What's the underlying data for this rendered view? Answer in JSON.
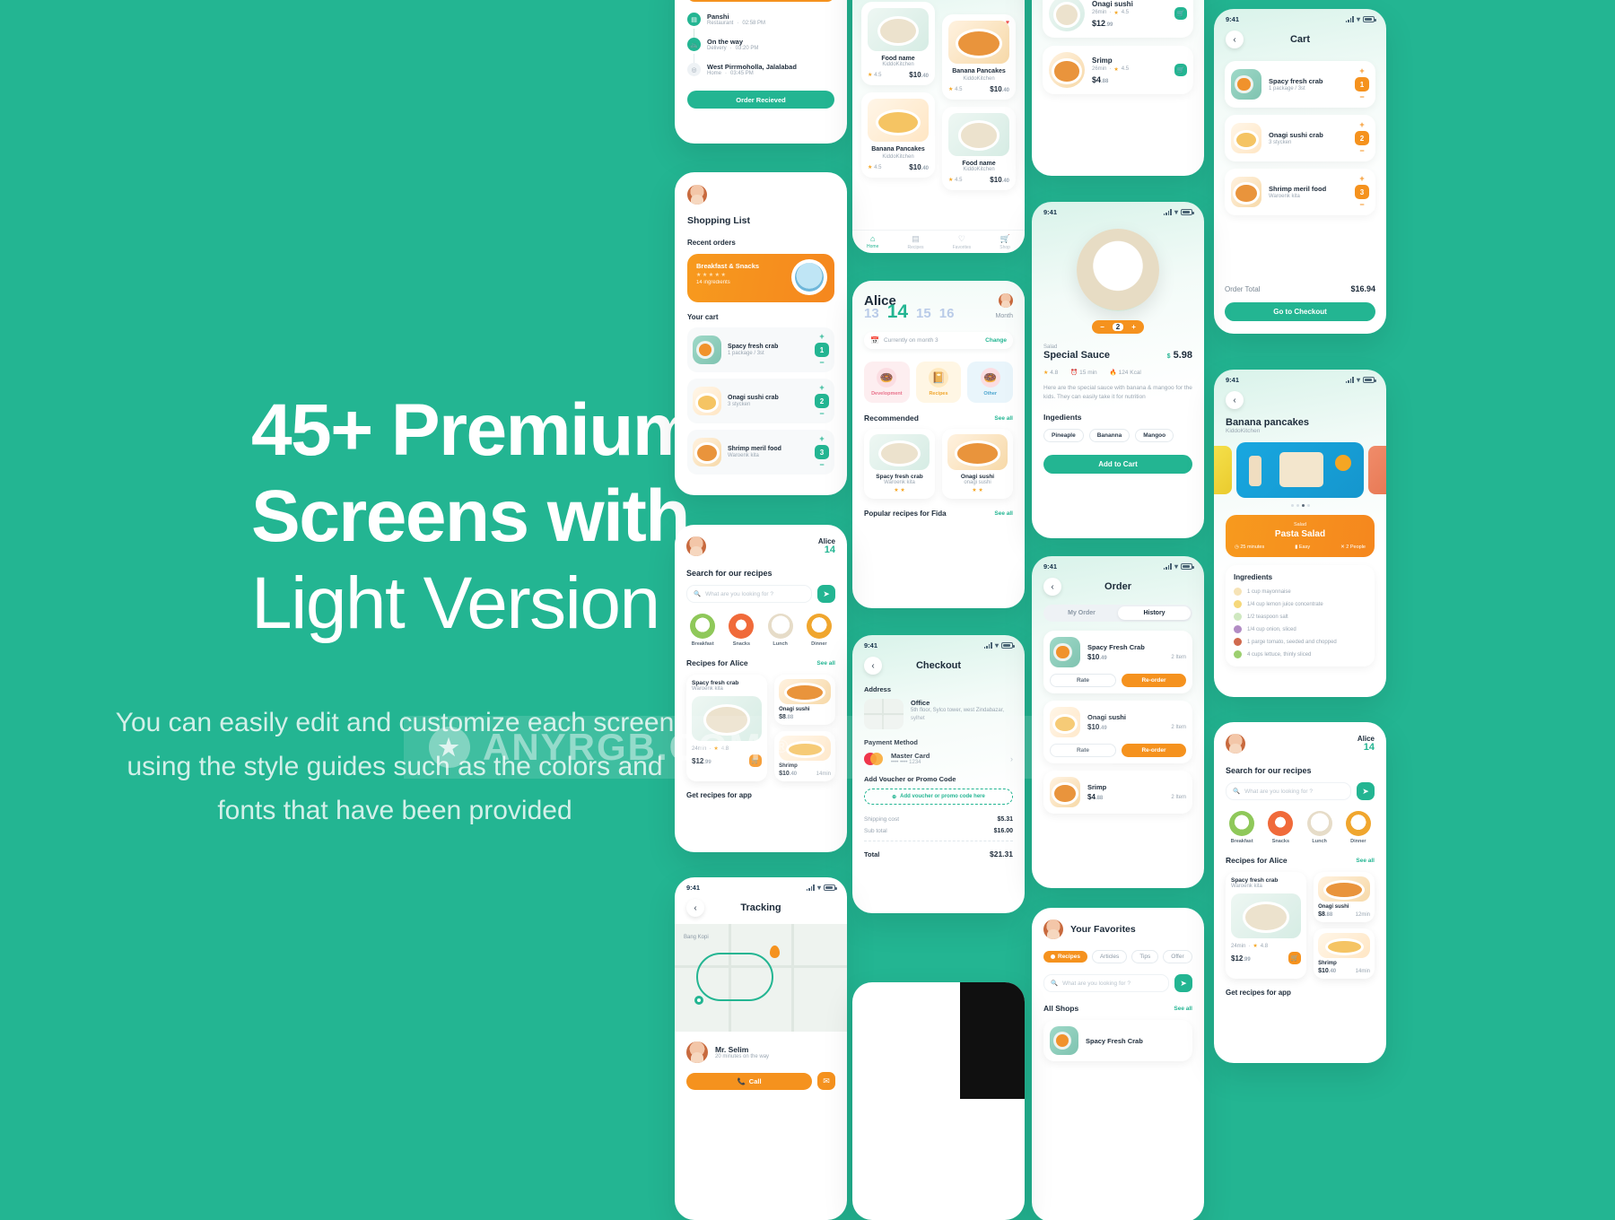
{
  "hero": {
    "title_line1": "45+ Premium",
    "title_line2": "Screens with",
    "title_line3": "Light Version",
    "subtitle": "You can easily edit and customize each screen using the style guides such as the colors and fonts that have been provided"
  },
  "watermark": {
    "text": "ANYRGB.COM",
    "reg": "®",
    "star": "★"
  },
  "colors": {
    "brand_green": "#23B592",
    "accent_orange": "#F5921E",
    "dark": "#1d2b3a",
    "muted": "#9aa6b2"
  },
  "status_bar": {
    "time": "9:41"
  },
  "screens": {
    "tracking_status": {
      "steps": [
        {
          "title": "Panshi",
          "sub": "Restaurant",
          "time": "02:58 PM",
          "icon": "store-icon"
        },
        {
          "title": "On the way",
          "sub": "Delivery",
          "time": "03:20 PM",
          "icon": "bike-icon"
        },
        {
          "title": "West Pirrmoholla, Jalalabad",
          "sub": "Home",
          "time": "03:45 PM",
          "icon": "pin-icon"
        }
      ],
      "button": "Order Recieved"
    },
    "home_grid": {
      "items": [
        {
          "name": "Food name",
          "brand": "KiddoKitchen",
          "rating": "4.5",
          "price": "$10",
          "cents": ".40"
        },
        {
          "name": "Banana Pancakes",
          "brand": "KiddoKitchen",
          "rating": "4.5",
          "price": "$10",
          "cents": ".40"
        },
        {
          "name": "Banana Pancakes",
          "brand": "KiddoKitchen",
          "rating": "4.5",
          "price": "$10",
          "cents": ".40"
        },
        {
          "name": "Food name",
          "brand": "KiddoKitchen",
          "rating": "4.5",
          "price": "$10",
          "cents": ".40"
        }
      ],
      "tabs": [
        {
          "label": "Home",
          "icon": "home-icon",
          "active": true
        },
        {
          "label": "Recipes",
          "icon": "book-icon",
          "active": false
        },
        {
          "label": "Favorites",
          "icon": "heart-icon",
          "active": false
        },
        {
          "label": "Shop",
          "icon": "cart-icon",
          "active": false
        }
      ]
    },
    "quick_list": {
      "items": [
        {
          "name": "Onagi sushi",
          "meta": "26min",
          "rating": "4.5",
          "price": "$12",
          "cents": ".99"
        },
        {
          "name": "Srimp",
          "meta": "26min",
          "rating": "4.5",
          "price": "$4",
          "cents": ".88"
        }
      ]
    },
    "cart": {
      "title": "Cart",
      "items": [
        {
          "name": "Spacy fresh crab",
          "sub": "1 package / 3st",
          "qty": "1"
        },
        {
          "name": "Onagi sushi crab",
          "sub": "3 stycken",
          "qty": "2"
        },
        {
          "name": "Shrimp meril food",
          "sub": "Waroenk kita",
          "qty": "3"
        }
      ],
      "total_label": "Order Total",
      "total_value": "$16.94",
      "button": "Go to Checkout"
    },
    "shopping_list": {
      "title": "Shopping List",
      "recent_label": "Recent orders",
      "recent_card": {
        "title": "Breakfast & Snacks",
        "stars": "★★★★★",
        "meta": "14 ingredients"
      },
      "cart_label": "Your cart",
      "items": [
        {
          "name": "Spacy fresh crab",
          "sub": "1 package / 3st",
          "qty": "1"
        },
        {
          "name": "Onagi sushi crab",
          "sub": "3 stycken",
          "qty": "2"
        },
        {
          "name": "Shrimp meril food",
          "sub": "Waroenk kita",
          "qty": "3"
        }
      ]
    },
    "calendar": {
      "name": "Alice",
      "period": "Month",
      "days": [
        "13",
        "14",
        "15",
        "16"
      ],
      "active_day": "14",
      "month_note": "Currently on month 3",
      "change": "Change",
      "categories": [
        {
          "label": "Development",
          "icon": "donut-icon"
        },
        {
          "label": "Recipes",
          "icon": "book-icon"
        },
        {
          "label": "Other",
          "icon": "donut-icon"
        }
      ],
      "recommended_label": "Recommended",
      "see_all": "See all",
      "recommended": [
        {
          "name": "Spacy fresh crab",
          "brand": "Waroenk kita",
          "stars": "★ ★"
        },
        {
          "name": "Onagi sushi",
          "brand": "onagi sushi",
          "stars": "★ ★"
        }
      ],
      "popular_label": "Popular recipes for Fida"
    },
    "detail": {
      "qty": "2",
      "category": "Salad",
      "name": "Special Sauce",
      "currency": "$",
      "price": "5.98",
      "rating": "4.8",
      "time": "15 min",
      "kcal": "124 Kcal",
      "description": "Here are the special sauce with banana & mangoo for the kids. They can easily take it for nutrition",
      "ingredients_label": "Ingedients",
      "ingredients": [
        "Pineaple",
        "Bananna",
        "Mangoo"
      ],
      "button": "Add to Cart"
    },
    "search_alice": {
      "user": "Alice",
      "count": "14",
      "heading": "Search for our recipes",
      "search_placeholder": "What are you looking for ?",
      "categories": [
        {
          "label": "Breakfast",
          "icon": "salad-icon"
        },
        {
          "label": "Snacks",
          "icon": "fries-icon"
        },
        {
          "label": "Lunch",
          "icon": "bowl-icon"
        },
        {
          "label": "Dinner",
          "icon": "plate-icon"
        }
      ],
      "recipes_label": "Recipes for Alice",
      "see_all": "See all",
      "big_card": {
        "name": "Spacy fresh crab",
        "brand": "Waroenk kita",
        "meta": "24min",
        "rating": "4.8",
        "price": "$12",
        "cents": ".99"
      },
      "small_cards": [
        {
          "name": "Onagi sushi",
          "price": "$8",
          "cents": ".88",
          "meta": "12min"
        },
        {
          "name": "Shrimp",
          "price": "$10",
          "cents": ".40",
          "meta": "14min"
        }
      ],
      "footer": "Get recipes for app"
    },
    "checkout": {
      "title": "Checkout",
      "address_label": "Address",
      "address_name": "Office",
      "address_value": "5th floor, Sylco tower, west Zindabazar, sylhet",
      "payment_label": "Payment Method",
      "card_name": "Master Card",
      "card_number": "•••• •••• 1234",
      "voucher_label": "Add Voucher or Promo Code",
      "voucher_placeholder": "Add voucher or promo code here",
      "totals": [
        {
          "label": "Shipping cost",
          "value": "$5.31"
        },
        {
          "label": "Sub total",
          "value": "$16.00"
        }
      ],
      "total_label": "Total",
      "total_value": "$21.31"
    },
    "order_history": {
      "title": "Order",
      "tabs": [
        {
          "label": "My Order",
          "active": false
        },
        {
          "label": "History",
          "active": true
        }
      ],
      "items": [
        {
          "name": "Spacy Fresh Crab",
          "price": "$10",
          "cents": ".49",
          "count": "2 Item",
          "rate": "Rate",
          "reorder": "Re-order"
        },
        {
          "name": "Onagi sushi",
          "price": "$10",
          "cents": ".49",
          "count": "2 Item",
          "rate": "Rate",
          "reorder": "Re-order"
        },
        {
          "name": "Srimp",
          "price": "$4",
          "cents": ".88",
          "count": "2 Item",
          "rate": "",
          "reorder": ""
        }
      ]
    },
    "recipe": {
      "title": "Banana pancakes",
      "brand": "KiddoKitchen",
      "banner": {
        "category": "Salad",
        "name": "Pasta Salad",
        "time": "25 minutes",
        "level": "Easy",
        "people": "2 People"
      },
      "ingredients_label": "Ingredients",
      "ingredients": [
        "1 cup mayonnaise",
        "1/4 cup lemon juice concentrate",
        "1/2 teaspoon salt",
        "1/4 cup onion, sliced",
        "1 parge tomato, seeded and chopped",
        "4 cups lettuce, thinly sliced"
      ]
    },
    "favorites": {
      "title": "Your Favorites",
      "tabs": [
        {
          "label": "Recipes",
          "active": true
        },
        {
          "label": "Articles",
          "active": false
        },
        {
          "label": "Tips",
          "active": false
        },
        {
          "label": "Offer",
          "active": false
        }
      ],
      "search_placeholder": "What are you looking for ?",
      "shops_label": "All Shops",
      "see_all": "See all",
      "first_item": "Spacy Fresh Crab"
    },
    "tracking_map": {
      "title": "Tracking",
      "map_label": "Bang Kopi",
      "courier_name": "Mr. Selim",
      "courier_sub": "20 minutes on the way",
      "call_button": "Call"
    }
  }
}
